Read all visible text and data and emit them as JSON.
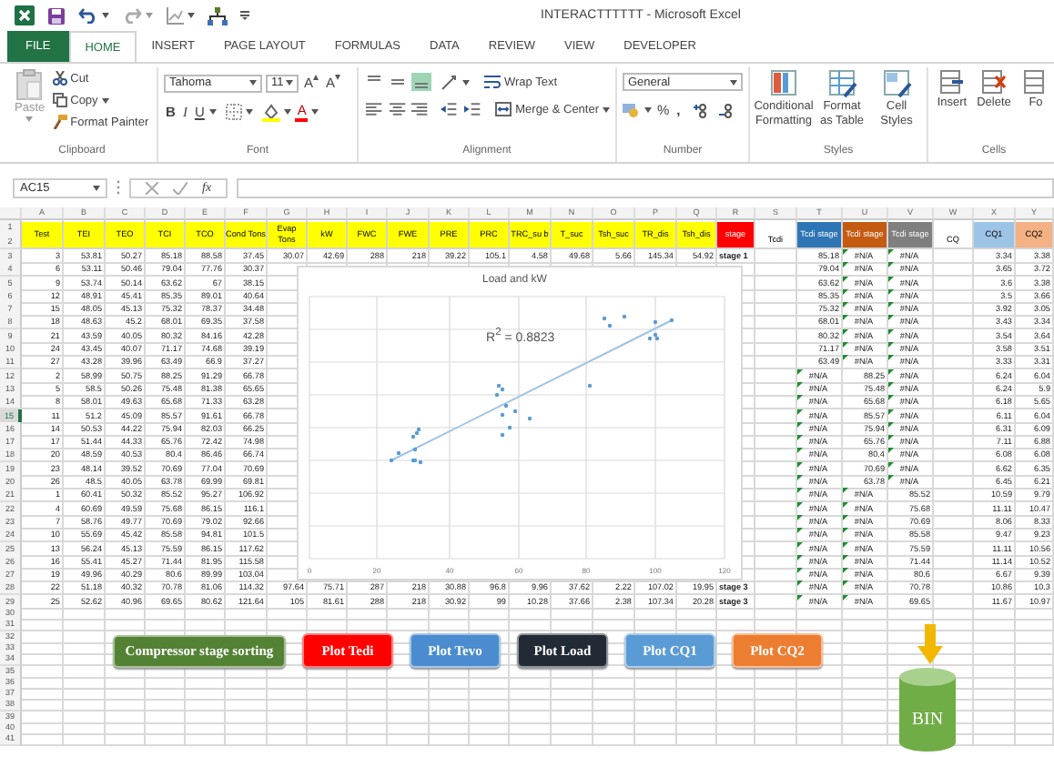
{
  "title_bar": {
    "title": "INTERACTTTTTT - Microsoft Excel"
  },
  "tabs": [
    {
      "label": "FILE",
      "kind": "file",
      "selected": false
    },
    {
      "label": "HOME",
      "kind": "tab",
      "selected": true
    },
    {
      "label": "INSERT",
      "kind": "tab",
      "selected": false
    },
    {
      "label": "PAGE LAYOUT",
      "kind": "tab",
      "selected": false
    },
    {
      "label": "FORMULAS",
      "kind": "tab",
      "selected": false
    },
    {
      "label": "DATA",
      "kind": "tab",
      "selected": false
    },
    {
      "label": "REVIEW",
      "kind": "tab",
      "selected": false
    },
    {
      "label": "VIEW",
      "kind": "tab",
      "selected": false
    },
    {
      "label": "DEVELOPER",
      "kind": "tab",
      "selected": false
    }
  ],
  "ribbon": {
    "clipboard": {
      "label": "Clipboard",
      "paste": "Paste",
      "paste_disabled": true,
      "cut": "Cut",
      "copy": "Copy",
      "format_painter": "Format Painter"
    },
    "font": {
      "label": "Font",
      "family": "Tahoma",
      "size": "11",
      "grow": "A",
      "shrink": "A",
      "bold": "B",
      "italic": "I",
      "underline": "U",
      "font_color": "A"
    },
    "alignment": {
      "label": "Alignment",
      "vertical": [
        {
          "kind": "top",
          "selected": false
        },
        {
          "kind": "middle",
          "selected": false
        },
        {
          "kind": "bottom",
          "selected": true
        }
      ],
      "wrap_text": "Wrap Text",
      "merge": "Merge & Center"
    },
    "number": {
      "label": "Number",
      "format": "General",
      "percent": "%",
      "comma": ","
    },
    "styles": {
      "label": "Styles",
      "items": [
        "Conditional Formatting",
        "Format as Table",
        "Cell Styles"
      ]
    },
    "cells": {
      "label": "Cells",
      "items": [
        "Insert",
        "Delete",
        "Fo"
      ]
    }
  },
  "formula_bar": {
    "name_box": "AC15",
    "fx": "fx"
  },
  "sheet": {
    "columns": [
      "A",
      "B",
      "C",
      "D",
      "E",
      "F",
      "G",
      "H",
      "I",
      "J",
      "K",
      "L",
      "M",
      "N",
      "O",
      "P",
      "Q",
      "R",
      "S",
      "T",
      "U",
      "V",
      "W",
      "X",
      "Y"
    ],
    "header_row_numbers": [
      "1",
      "2"
    ],
    "headers": [
      {
        "text": "Test",
        "color": "#ffff00",
        "kind": "merged"
      },
      {
        "text": "TEI",
        "color": "#ffff00",
        "kind": "merged"
      },
      {
        "text": "TEO",
        "color": "#ffff00",
        "kind": "merged"
      },
      {
        "text": "TCI",
        "color": "#ffff00",
        "kind": "merged"
      },
      {
        "text": "TCO",
        "color": "#ffff00",
        "kind": "merged"
      },
      {
        "text": "Cond Tons",
        "color": "#ffff00",
        "kind": "merged"
      },
      {
        "text": "Evap Tons",
        "color": "#ffff00",
        "kind": "merged"
      },
      {
        "text": "kW",
        "color": "#ffff00",
        "kind": "merged"
      },
      {
        "text": "FWC",
        "color": "#ffff00",
        "kind": "merged"
      },
      {
        "text": "FWE",
        "color": "#ffff00",
        "kind": "merged"
      },
      {
        "text": "PRE",
        "color": "#ffff00",
        "kind": "merged"
      },
      {
        "text": "PRC",
        "color": "#ffff00",
        "kind": "merged"
      },
      {
        "text": "TRC_su b",
        "color": "#ffff00",
        "kind": "merged"
      },
      {
        "text": "T_suc",
        "color": "#ffff00",
        "kind": "merged"
      },
      {
        "text": "Tsh_suc",
        "color": "#ffff00",
        "kind": "merged"
      },
      {
        "text": "TR_dis",
        "color": "#ffff00",
        "kind": "merged"
      },
      {
        "text": "Tsh_dis",
        "color": "#ffff00",
        "kind": "merged"
      },
      {
        "text": "stage",
        "color": "#ff0000",
        "kind": "merged"
      },
      {
        "text": "Tcdi",
        "color": "#ffffff",
        "kind": "lower"
      },
      {
        "text": "Tcdi stage",
        "color": "#2e75b6",
        "kind": "merged"
      },
      {
        "text": "Tcdi stage",
        "color": "#c55a11",
        "kind": "merged"
      },
      {
        "text": "Tcdi stage",
        "color": "#7f7f7f",
        "kind": "merged"
      },
      {
        "text": "CQ",
        "color": "#ffffff",
        "kind": "lower"
      },
      {
        "text": "CQ1",
        "color": "#9dc3e6",
        "kind": "merged"
      },
      {
        "text": "CQ2",
        "color": "#f4b183",
        "kind": "merged"
      }
    ],
    "rows": [
      {
        "n": "3",
        "selected": false,
        "cells": [
          "3",
          "53.81",
          "50.27",
          "85.18",
          "88.58",
          "37.45",
          "30.07",
          "42.69",
          "288",
          "218",
          "39.22",
          "105.1",
          "4.58",
          "49.68",
          "5.66",
          "145.34",
          "54.92",
          "stage 1",
          null,
          "85.18",
          "#N/A",
          "#N/A",
          null,
          "3.34",
          "3.38"
        ],
        "flags": [
          false,
          true,
          true
        ]
      },
      {
        "n": "4",
        "selected": false,
        "cells": [
          "6",
          "53.11",
          "50.46",
          "79.04",
          "77.76",
          "30.37",
          null,
          null,
          null,
          null,
          null,
          null,
          null,
          null,
          null,
          null,
          null,
          null,
          null,
          "79.04",
          "#N/A",
          "#N/A",
          null,
          "3.65",
          "3.72"
        ],
        "flags": [
          false,
          true,
          true
        ]
      },
      {
        "n": "5",
        "selected": false,
        "cells": [
          "9",
          "53.74",
          "50.14",
          "63.62",
          "67",
          "38.15",
          null,
          null,
          null,
          null,
          null,
          null,
          null,
          null,
          null,
          null,
          null,
          null,
          null,
          "63.62",
          "#N/A",
          "#N/A",
          null,
          "3.6",
          "3.38"
        ],
        "flags": [
          false,
          true,
          true
        ]
      },
      {
        "n": "6",
        "selected": false,
        "cells": [
          "12",
          "48.91",
          "45.41",
          "85.35",
          "89.01",
          "40.64",
          null,
          null,
          null,
          null,
          null,
          null,
          null,
          null,
          null,
          null,
          null,
          null,
          null,
          "85.35",
          "#N/A",
          "#N/A",
          null,
          "3.5",
          "3.66"
        ],
        "flags": [
          false,
          true,
          true
        ]
      },
      {
        "n": "7",
        "selected": false,
        "cells": [
          "15",
          "48.05",
          "45.13",
          "75.32",
          "78.37",
          "34.48",
          null,
          null,
          null,
          null,
          null,
          null,
          null,
          null,
          null,
          null,
          null,
          null,
          null,
          "75.32",
          "#N/A",
          "#N/A",
          null,
          "3.92",
          "3.05"
        ],
        "flags": [
          false,
          true,
          true
        ]
      },
      {
        "n": "8",
        "selected": false,
        "cells": [
          "18",
          "48.63",
          "45.2",
          "68.01",
          "69.35",
          "37.58",
          null,
          null,
          null,
          null,
          null,
          null,
          null,
          null,
          null,
          null,
          null,
          null,
          null,
          "68.01",
          "#N/A",
          "#N/A",
          null,
          "3.43",
          "3.34"
        ],
        "flags": [
          false,
          true,
          true
        ]
      },
      {
        "n": "9",
        "selected": false,
        "cells": [
          "21",
          "43.59",
          "40.05",
          "80.32",
          "84.16",
          "42.28",
          null,
          null,
          null,
          null,
          null,
          null,
          null,
          null,
          null,
          null,
          null,
          null,
          null,
          "80.32",
          "#N/A",
          "#N/A",
          null,
          "3.54",
          "3.64"
        ],
        "flags": [
          false,
          true,
          true
        ]
      },
      {
        "n": "10",
        "selected": false,
        "cells": [
          "24",
          "43.45",
          "40.07",
          "71.17",
          "74.68",
          "39.19",
          null,
          null,
          null,
          null,
          null,
          null,
          null,
          null,
          null,
          null,
          null,
          null,
          null,
          "71.17",
          "#N/A",
          "#N/A",
          null,
          "3.58",
          "3.51"
        ],
        "flags": [
          false,
          true,
          true
        ]
      },
      {
        "n": "11",
        "selected": false,
        "cells": [
          "27",
          "43.28",
          "39.96",
          "63.49",
          "66.9",
          "37.27",
          null,
          null,
          null,
          null,
          null,
          null,
          null,
          null,
          null,
          null,
          null,
          null,
          null,
          "63.49",
          "#N/A",
          "#N/A",
          null,
          "3.33",
          "3.31"
        ],
        "flags": [
          false,
          true,
          true
        ]
      },
      {
        "n": "12",
        "selected": false,
        "cells": [
          "2",
          "58.99",
          "50.75",
          "88.25",
          "91.29",
          "66.78",
          null,
          null,
          null,
          null,
          null,
          null,
          null,
          null,
          null,
          null,
          null,
          null,
          null,
          "#N/A",
          "88.25",
          "#N/A",
          null,
          "6.24",
          "6.04"
        ],
        "flags": [
          true,
          false,
          true
        ]
      },
      {
        "n": "13",
        "selected": false,
        "cells": [
          "5",
          "58.5",
          "50.26",
          "75.48",
          "81.38",
          "65.65",
          null,
          null,
          null,
          null,
          null,
          null,
          null,
          null,
          null,
          null,
          null,
          null,
          null,
          "#N/A",
          "75.48",
          "#N/A",
          null,
          "6.24",
          "5.9"
        ],
        "flags": [
          true,
          false,
          true
        ]
      },
      {
        "n": "14",
        "selected": false,
        "cells": [
          "8",
          "58.01",
          "49.63",
          "65.68",
          "71.33",
          "63.28",
          null,
          null,
          null,
          null,
          null,
          null,
          null,
          null,
          null,
          null,
          null,
          null,
          null,
          "#N/A",
          "65.68",
          "#N/A",
          null,
          "6.18",
          "5.65"
        ],
        "flags": [
          true,
          false,
          true
        ]
      },
      {
        "n": "15",
        "selected": true,
        "cells": [
          "11",
          "51.2",
          "45.09",
          "85.57",
          "91.61",
          "66.78",
          null,
          null,
          null,
          null,
          null,
          null,
          null,
          null,
          null,
          null,
          null,
          null,
          null,
          "#N/A",
          "85.57",
          "#N/A",
          null,
          "6.11",
          "6.04"
        ],
        "flags": [
          true,
          false,
          true
        ]
      },
      {
        "n": "16",
        "selected": false,
        "cells": [
          "14",
          "50.53",
          "44.22",
          "75.94",
          "82.03",
          "66.25",
          null,
          null,
          null,
          null,
          null,
          null,
          null,
          null,
          null,
          null,
          null,
          null,
          null,
          "#N/A",
          "75.94",
          "#N/A",
          null,
          "6.31",
          "6.09"
        ],
        "flags": [
          true,
          false,
          true
        ]
      },
      {
        "n": "17",
        "selected": false,
        "cells": [
          "17",
          "51.44",
          "44.33",
          "65.76",
          "72.42",
          "74.98",
          null,
          null,
          null,
          null,
          null,
          null,
          null,
          null,
          null,
          null,
          null,
          null,
          null,
          "#N/A",
          "65.76",
          "#N/A",
          null,
          "7.11",
          "6.88"
        ],
        "flags": [
          true,
          false,
          true
        ]
      },
      {
        "n": "18",
        "selected": false,
        "cells": [
          "20",
          "48.59",
          "40.53",
          "80.4",
          "86.46",
          "66.74",
          null,
          null,
          null,
          null,
          null,
          null,
          null,
          null,
          null,
          null,
          null,
          null,
          null,
          "#N/A",
          "80.4",
          "#N/A",
          null,
          "6.08",
          "6.08"
        ],
        "flags": [
          true,
          false,
          true
        ]
      },
      {
        "n": "19",
        "selected": false,
        "cells": [
          "23",
          "48.14",
          "39.52",
          "70.69",
          "77.04",
          "70.69",
          null,
          null,
          null,
          null,
          null,
          null,
          null,
          null,
          null,
          null,
          null,
          null,
          null,
          "#N/A",
          "70.69",
          "#N/A",
          null,
          "6.62",
          "6.35"
        ],
        "flags": [
          true,
          false,
          true
        ]
      },
      {
        "n": "20",
        "selected": false,
        "cells": [
          "26",
          "48.5",
          "40.05",
          "63.78",
          "69.99",
          "69.81",
          null,
          null,
          null,
          null,
          null,
          null,
          null,
          null,
          null,
          null,
          null,
          null,
          null,
          "#N/A",
          "63.78",
          "#N/A",
          null,
          "6.45",
          "6.21"
        ],
        "flags": [
          true,
          false,
          true
        ]
      },
      {
        "n": "21",
        "selected": false,
        "cells": [
          "1",
          "60.41",
          "50.32",
          "85.52",
          "95.27",
          "106.92",
          null,
          null,
          null,
          null,
          null,
          null,
          null,
          null,
          null,
          null,
          null,
          null,
          null,
          "#N/A",
          "#N/A",
          "85.52",
          null,
          "10.59",
          "9.79"
        ],
        "flags": [
          true,
          true,
          false
        ]
      },
      {
        "n": "22",
        "selected": false,
        "cells": [
          "4",
          "60.69",
          "49.59",
          "75.68",
          "86.15",
          "116.1",
          null,
          null,
          null,
          null,
          null,
          null,
          null,
          null,
          null,
          null,
          null,
          null,
          null,
          "#N/A",
          "#N/A",
          "75.68",
          null,
          "11.11",
          "10.47"
        ],
        "flags": [
          true,
          true,
          false
        ]
      },
      {
        "n": "23",
        "selected": false,
        "cells": [
          "7",
          "58.76",
          "49.77",
          "70.69",
          "79.02",
          "92.66",
          null,
          null,
          null,
          null,
          null,
          null,
          null,
          null,
          null,
          null,
          null,
          null,
          null,
          "#N/A",
          "#N/A",
          "70.69",
          null,
          "8.06",
          "8.33"
        ],
        "flags": [
          true,
          true,
          false
        ]
      },
      {
        "n": "24",
        "selected": false,
        "cells": [
          "10",
          "55.69",
          "45.42",
          "85.58",
          "94.81",
          "101.5",
          null,
          null,
          null,
          null,
          null,
          null,
          null,
          null,
          null,
          null,
          null,
          null,
          null,
          "#N/A",
          "#N/A",
          "85.58",
          null,
          "9.47",
          "9.23"
        ],
        "flags": [
          true,
          true,
          false
        ]
      },
      {
        "n": "25",
        "selected": false,
        "cells": [
          "13",
          "56.24",
          "45.13",
          "75.59",
          "86.15",
          "117.62",
          null,
          null,
          null,
          null,
          null,
          null,
          null,
          null,
          null,
          null,
          null,
          null,
          null,
          "#N/A",
          "#N/A",
          "75.59",
          null,
          "11.11",
          "10.56"
        ],
        "flags": [
          true,
          true,
          false
        ]
      },
      {
        "n": "26",
        "selected": false,
        "cells": [
          "16",
          "55.41",
          "45.27",
          "71.44",
          "81.95",
          "115.58",
          null,
          null,
          null,
          null,
          null,
          null,
          null,
          null,
          null,
          null,
          null,
          null,
          null,
          "#N/A",
          "#N/A",
          "71.44",
          null,
          "11.14",
          "10.52"
        ],
        "flags": [
          true,
          true,
          false
        ]
      },
      {
        "n": "27",
        "selected": false,
        "cells": [
          "19",
          "49.96",
          "40.29",
          "80.6",
          "89.99",
          "103.04",
          null,
          null,
          null,
          null,
          null,
          null,
          null,
          null,
          null,
          null,
          null,
          null,
          null,
          "#N/A",
          "#N/A",
          "80.6",
          null,
          "6.67",
          "9.39"
        ],
        "flags": [
          true,
          true,
          false
        ]
      },
      {
        "n": "28",
        "selected": false,
        "cells": [
          "22",
          "51.18",
          "40.32",
          "70.78",
          "81.06",
          "114.32",
          "97.64",
          "75.71",
          "287",
          "218",
          "30.88",
          "96.8",
          "9.96",
          "37.62",
          "2.22",
          "107.02",
          "19.95",
          "stage 3",
          null,
          "#N/A",
          "#N/A",
          "70.78",
          null,
          "10.86",
          "10.3"
        ],
        "flags": [
          true,
          true,
          false
        ]
      },
      {
        "n": "29",
        "selected": false,
        "cells": [
          "25",
          "52.62",
          "40.96",
          "69.65",
          "80.62",
          "121.64",
          "105",
          "81.61",
          "288",
          "218",
          "30.92",
          "99",
          "10.28",
          "37.66",
          "2.38",
          "107.34",
          "20.28",
          "stage 3",
          null,
          "#N/A",
          "#N/A",
          "69.65",
          null,
          "11.67",
          "10.97"
        ],
        "flags": [
          true,
          true,
          false
        ]
      }
    ],
    "empty_row_numbers": [
      "30",
      "31",
      "32",
      "33",
      "34",
      "35",
      "36",
      "37",
      "38",
      "39",
      "40",
      "41"
    ]
  },
  "chart": {
    "title": "Load and kW",
    "r_squared": "R$^{2}$ = 0.8823",
    "x_tick_labels": [
      "0",
      "20",
      "40",
      "60",
      "80",
      "100",
      "120"
    ]
  },
  "buttons": [
    {
      "label": "Compressor stage sorting",
      "color": "#548235"
    },
    {
      "label": "Plot Tedi",
      "color": "#ff0000"
    },
    {
      "label": "Plot Tevo",
      "color": "#4a8ccf"
    },
    {
      "label": "Plot Load",
      "color": "#222a35"
    },
    {
      "label": "Plot CQ1",
      "color": "#5b9bd5"
    },
    {
      "label": "Plot CQ2",
      "color": "#ed7d31"
    }
  ],
  "bin": {
    "label": "BIN"
  }
}
